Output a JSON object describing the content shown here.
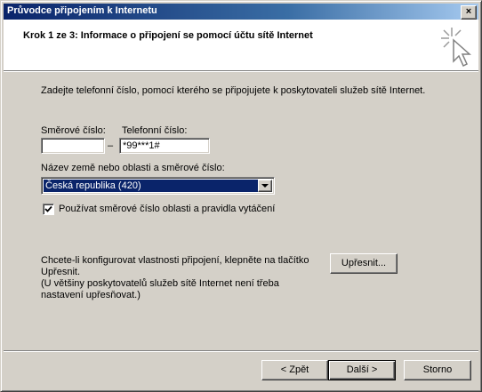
{
  "window": {
    "title": "Průvodce připojením k Internetu",
    "close_label": "×"
  },
  "header": {
    "title": "Krok 1 ze 3: Informace o připojení se pomocí účtu sítě Internet",
    "icon": "wizard-cursor-icon"
  },
  "body": {
    "intro": "Zadejte telefonní číslo, pomocí kterého se připojujete k poskytovateli služeb sítě Internet.",
    "area_code_label": "Směrové číslo:",
    "area_code_value": "",
    "phone_label": "Telefonní číslo:",
    "phone_value": "*99***1#",
    "dash": "–",
    "country_label": "Název země nebo oblasti a směrové číslo:",
    "country_value": "Česká republika (420)",
    "use_area_code_label": "Používat směrové číslo oblasti a pravidla vytáčení",
    "use_area_code_checked": true,
    "config_text": "Chcete-li konfigurovat vlastnosti připojení, klepněte na tlačítko Upřesnit.\n(U většiny poskytovatelů služeb sítě Internet není třeba nastavení upřesňovat.)",
    "advanced_button": "Upřesnit..."
  },
  "footer": {
    "back_button": "< Zpět",
    "next_button": "Další >",
    "cancel_button": "Storno"
  }
}
